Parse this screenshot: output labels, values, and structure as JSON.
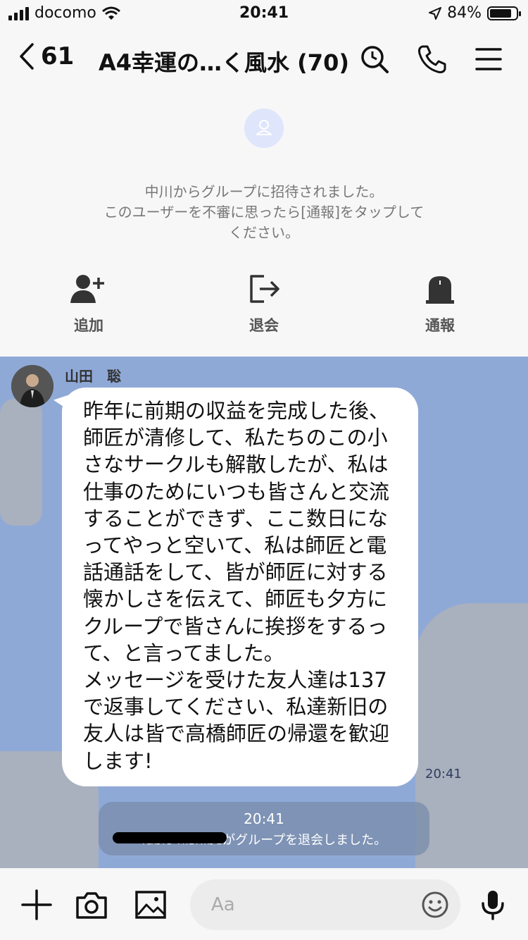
{
  "status_bar": {
    "carrier": "docomo",
    "time": "20:41",
    "battery": "84%",
    "battery_level": 0.84
  },
  "header": {
    "back_count": "61",
    "title": "A4幸運の…く風水 (70)"
  },
  "system": {
    "invite_line1": "中川からグループに招待されました。",
    "invite_line2": "このユーザーを不審に思ったら[通報]をタップして",
    "invite_line3": "ください。",
    "actions": [
      {
        "label": "追加",
        "icon": "add-friend-icon"
      },
      {
        "label": "退会",
        "icon": "leave-icon"
      },
      {
        "label": "通報",
        "icon": "report-icon"
      }
    ]
  },
  "chat": {
    "sender": "山田　聡",
    "message": "昨年に前期の収益を完成した後、\n師匠が清修して、私たちのこの小\nさなサークルも解散したが、私は\n仕事のためにいつも皆さんと交流\nすることができず、ここ数日にな\nってやっと空いて、私は師匠と電\n話通話をして、皆が師匠に対する\n懐かしさを伝えて、師匠も夕方に\nクループで皆さんに挨拶をするっ\nて、と言ってました。\nメッセージを受けた友人達は137\nで返事してください、私達新旧の\n友人は皆で高橋師匠の帰還を歓迎\nします!",
    "message_time": "20:41",
    "notice_time": "20:41",
    "notice_text": "fabio nishibeがグループを退会しました。"
  },
  "input": {
    "placeholder": "Aa"
  },
  "colors": {
    "chat_bg": "#8fa9d7",
    "bubble": "#ffffff",
    "header_bg": "#f7f7f7"
  }
}
